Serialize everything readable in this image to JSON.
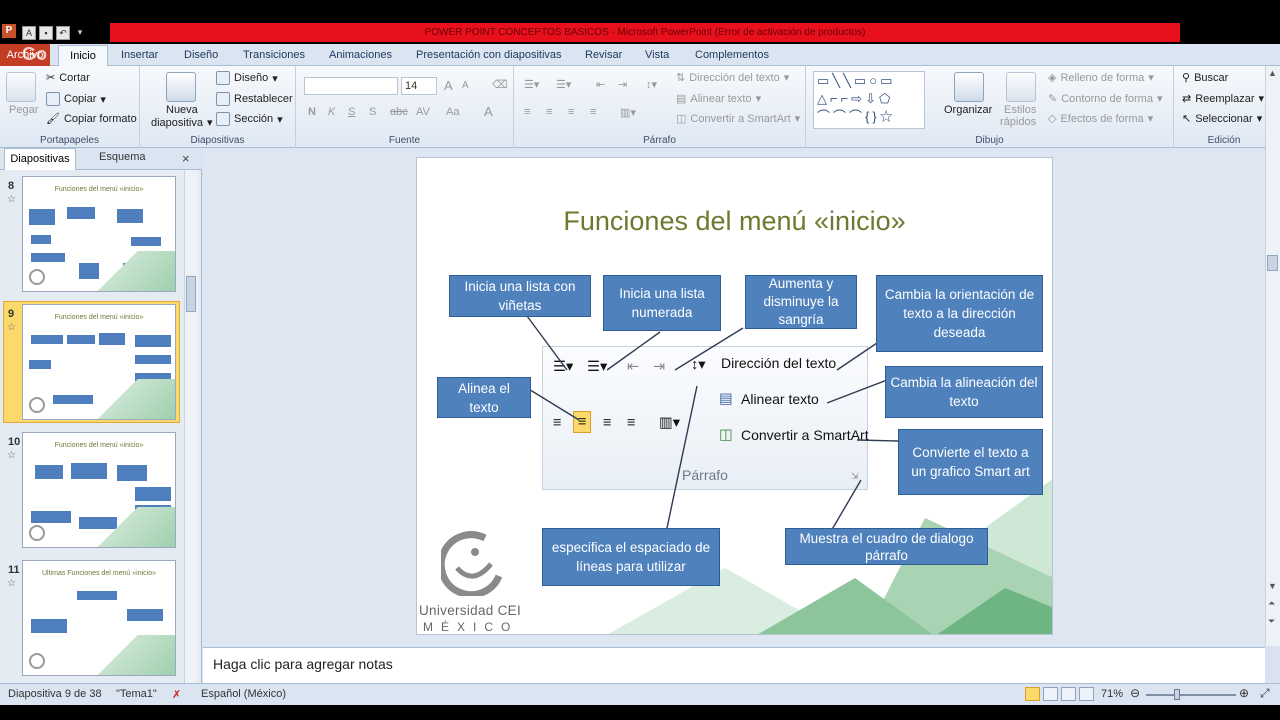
{
  "window": {
    "title": "POWER POINT CONCEPTOS BASICOS  -  Microsoft PowerPoint (Error de activación de productos)",
    "app_icon": "P",
    "overlay_text": "Go"
  },
  "qat": [
    "A",
    "save-icon",
    "undo-icon"
  ],
  "tabs": [
    "Archivo",
    "Inicio",
    "Insertar",
    "Diseño",
    "Transiciones",
    "Animaciones",
    "Presentación con diapositivas",
    "Revisar",
    "Vista",
    "Complementos"
  ],
  "ribbon": {
    "portapapeles": {
      "paste": "Pegar",
      "cut": "Cortar",
      "copy": "Copiar",
      "format_painter": "Copiar formato",
      "label": "Portapapeles"
    },
    "diapositivas": {
      "new_slide_1": "Nueva",
      "new_slide_2": "diapositiva",
      "layout": "Diseño",
      "reset": "Restablecer",
      "section": "Sección",
      "label": "Diapositivas"
    },
    "fuente": {
      "font_name": "",
      "font_size": "14",
      "label": "Fuente",
      "bold": "N",
      "italic": "K",
      "underline": "S",
      "shadow": "S",
      "strike": "abc",
      "spacing": "AV",
      "case": "Aa",
      "color": "A",
      "grow": "A",
      "shrink": "A"
    },
    "parrafo": {
      "text_direction": "Dirección del texto",
      "align_text": "Alinear texto",
      "smartart": "Convertir a SmartArt",
      "label": "Párrafo"
    },
    "dibujo": {
      "arrange": "Organizar",
      "quick_styles_1": "Estilos",
      "quick_styles_2": "rápidos",
      "fill": "Relleno de forma",
      "outline": "Contorno de forma",
      "effects": "Efectos de forma",
      "label": "Dibujo"
    },
    "edicion": {
      "find": "Buscar",
      "replace": "Reemplazar",
      "select": "Seleccionar",
      "label": "Edición"
    }
  },
  "panel": {
    "tabs": [
      "Diapositivas",
      "Esquema"
    ],
    "close": "×",
    "thumbs": [
      {
        "num": "8",
        "title": "Funciones del menú «inicio»"
      },
      {
        "num": "9",
        "title": "Funciones del menú «inicio»"
      },
      {
        "num": "10",
        "title": "Funciones del menú «inicio»"
      },
      {
        "num": "11",
        "title": "Ultimas Funciones del menú «inicio»"
      }
    ],
    "star": "☆"
  },
  "slide": {
    "title": "Funciones del menú «inicio»",
    "callouts": {
      "vinetas": "Inicia una lista con viñetas",
      "numerada": "Inicia una lista numerada",
      "sangria": "Aumenta y disminuye la sangría",
      "orientacion": "Cambia la orientación de texto a la dirección deseada",
      "alinea": "Alinea el texto",
      "alineacion": "Cambia la alineación del texto",
      "smartart": "Convierte el texto a un grafico Smart art",
      "espaciado": "especifica el espaciado de líneas para utilizar",
      "dialogo": "Muestra el cuadro de dialogo párrafo"
    },
    "paragraph_group": {
      "text_direction": "Dirección del texto",
      "align_text": "Alinear texto",
      "smartart": "Convertir a SmartArt",
      "label": "Párrafo"
    },
    "logo": {
      "name": "Universidad CEI",
      "country": "MÉXICO"
    }
  },
  "notes": {
    "placeholder": "Haga clic para agregar notas"
  },
  "status": {
    "slide_info": "Diapositiva 9 de 38",
    "theme": "\"Tema1\"",
    "language": "Español (México)",
    "zoom": "71%",
    "zoom_level": 0.71
  },
  "colors": {
    "accent_box": "#4f81bd",
    "title_green": "#6b7a2e",
    "file_tab": "#c43c24",
    "title_bar_red": "#e8101c"
  }
}
